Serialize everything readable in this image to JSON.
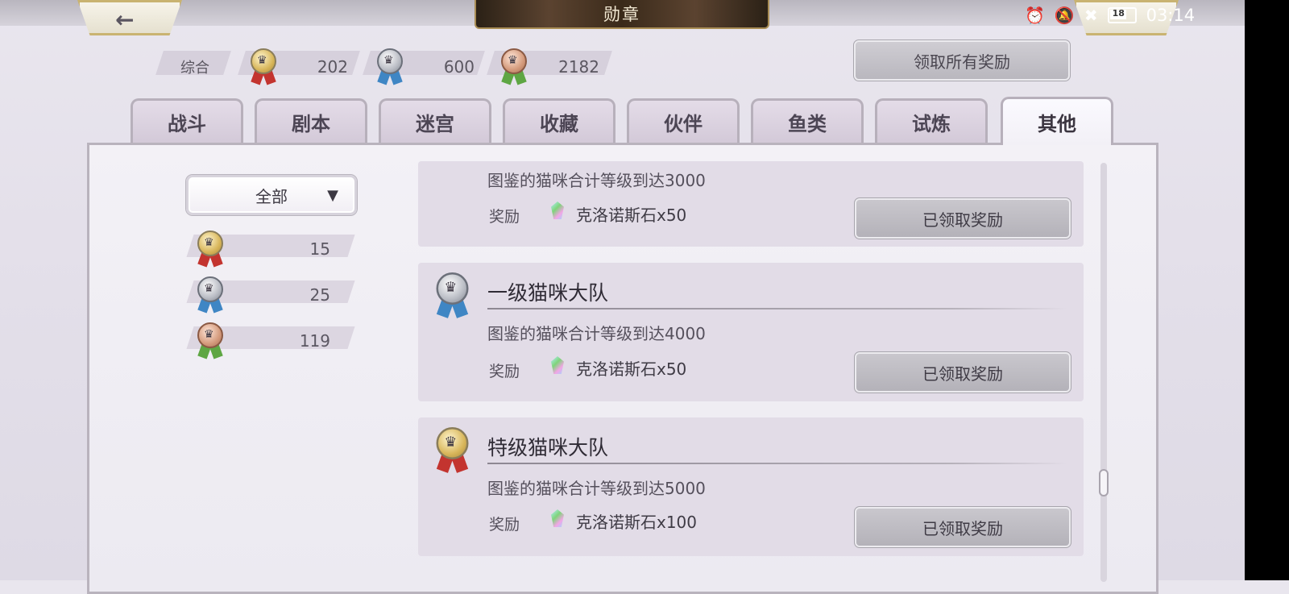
{
  "header": {
    "title": "勋章",
    "back_icon": "arrow-left-icon"
  },
  "status_bar": {
    "time": "03:14",
    "battery": "18"
  },
  "summary": {
    "label": "综合",
    "gold": "202",
    "silver": "600",
    "bronze": "2182"
  },
  "claim_all_label": "领取所有奖励",
  "tabs": [
    {
      "label": "战斗"
    },
    {
      "label": "剧本"
    },
    {
      "label": "迷宫"
    },
    {
      "label": "收藏"
    },
    {
      "label": "伙伴"
    },
    {
      "label": "鱼类"
    },
    {
      "label": "试炼"
    },
    {
      "label": "其他"
    }
  ],
  "active_tab": "其他",
  "filter": {
    "selected": "全部"
  },
  "side_counts": {
    "gold": "15",
    "silver": "25",
    "bronze": "119"
  },
  "cards": [
    {
      "title": "",
      "desc": "图鉴的猫咪合计等级到达3000",
      "reward_label": "奖励",
      "reward": "克洛诺斯石x50",
      "button": "已领取奖励"
    },
    {
      "title": "一级猫咪大队",
      "medal": "silver",
      "desc": "图鉴的猫咪合计等级到达4000",
      "reward_label": "奖励",
      "reward": "克洛诺斯石x50",
      "button": "已领取奖励"
    },
    {
      "title": "特级猫咪大队",
      "medal": "gold",
      "desc": "图鉴的猫咪合计等级到达5000",
      "reward_label": "奖励",
      "reward": "克洛诺斯石x100",
      "button": "已领取奖励"
    }
  ],
  "colors": {
    "gold_ribbon": "#c3342f",
    "silver_ribbon": "#3f86c4",
    "bronze_ribbon": "#5ea643",
    "title_plate": "#3a2a1a"
  }
}
